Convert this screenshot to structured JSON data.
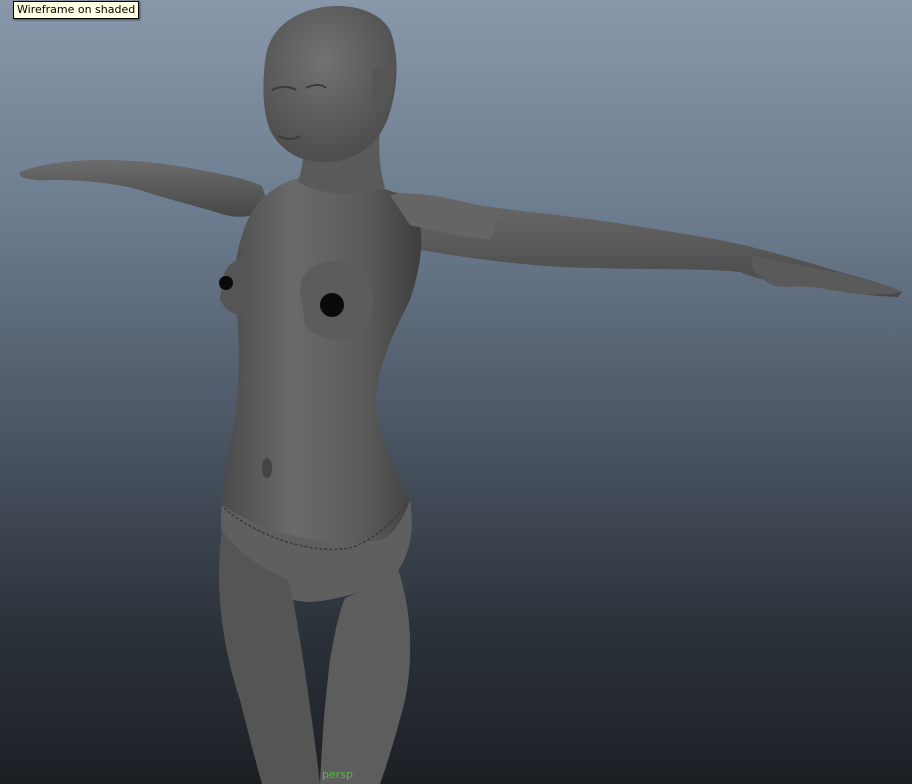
{
  "viewport": {
    "tooltip_text": "Wireframe on shaded",
    "camera_label": "persp",
    "camera_label_color": "#4fbf3f",
    "background_top_color": "#8897a9",
    "background_bottom_color": "#1c2025",
    "model_color": "#5e5e5e"
  }
}
